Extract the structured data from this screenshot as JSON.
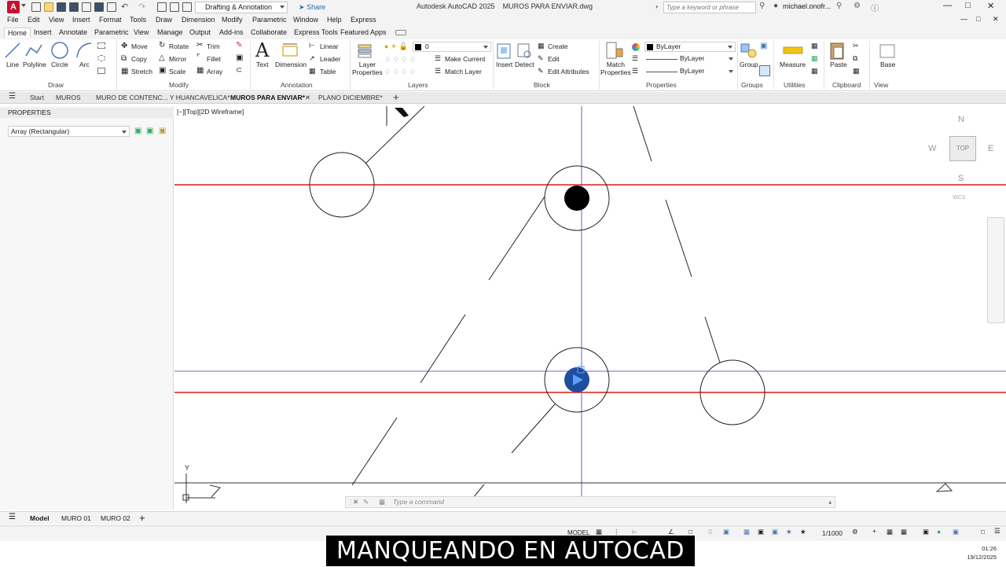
{
  "titlebar": {
    "logo": "A",
    "workspace": "Drafting & Annotation",
    "share": "Share",
    "app_name": "Autodesk AutoCAD 2025",
    "file_name": "MUROS PARA ENVIAR.dwg",
    "search_placeholder": "Type a keyword or phrase",
    "user": "michael.onofr..."
  },
  "menu": [
    "File",
    "Edit",
    "View",
    "Insert",
    "Format",
    "Tools",
    "Draw",
    "Dimension",
    "Modify",
    "Parametric",
    "Window",
    "Help",
    "Express"
  ],
  "ribbon_tabs": [
    "Home",
    "Insert",
    "Annotate",
    "Parametric",
    "View",
    "Manage",
    "Output",
    "Add-ins",
    "Collaborate",
    "Express Tools",
    "Featured Apps"
  ],
  "ribbon": {
    "draw": {
      "line": "Line",
      "polyline": "Polyline",
      "circle": "Circle",
      "arc": "Arc",
      "panel": "Draw"
    },
    "modify": {
      "move": "Move",
      "rotate": "Rotate",
      "trim": "Trim",
      "copy": "Copy",
      "mirror": "Mirror",
      "fillet": "Fillet",
      "stretch": "Stretch",
      "scale": "Scale",
      "array": "Array",
      "panel": "Modify"
    },
    "annotation": {
      "text": "Text",
      "dimension": "Dimension",
      "linear": "Linear",
      "leader": "Leader",
      "table": "Table",
      "panel": "Annotation"
    },
    "layers": {
      "layer_properties": "Layer\nProperties",
      "current_layer": "0",
      "make_current": "Make Current",
      "match_layer": "Match Layer",
      "panel": "Layers"
    },
    "block": {
      "insert": "Insert",
      "detect": "Detect",
      "create": "Create",
      "edit": "Edit",
      "edit_attributes": "Edit Attributes",
      "panel": "Block"
    },
    "properties": {
      "match": "Match\nProperties",
      "color": "ByLayer",
      "linetype": "ByLayer",
      "lineweight": "ByLayer",
      "panel": "Properties"
    },
    "groups": {
      "group": "Group",
      "panel": "Groups"
    },
    "utilities": {
      "measure": "Measure",
      "panel": "Utilities"
    },
    "clipboard": {
      "paste": "Paste",
      "panel": "Clipboard"
    },
    "view": {
      "base": "Base",
      "panel": "View"
    }
  },
  "file_tabs": [
    "Start",
    "MUROS",
    "MURO DE CONTENC... Y HUANCAVELICA*",
    "MUROS PARA ENVIAR*",
    "PLANO DICIEMBRE*"
  ],
  "properties_palette": {
    "title": "PROPERTIES",
    "selection": "Array (Rectangular)"
  },
  "viewport": {
    "label": "[−][Top][2D Wireframe]",
    "viewcube": {
      "n": "N",
      "s": "S",
      "e": "E",
      "w": "W",
      "face": "TOP",
      "wcs": "WCS"
    },
    "ucs_y": "Y"
  },
  "command_line": {
    "placeholder": "Type a command"
  },
  "layout_tabs": [
    "Model",
    "MURO 01",
    "MURO 02"
  ],
  "status_bar": {
    "model": "MODEL",
    "scale": "1/1000"
  },
  "overlay_banner": "MANQUEANDO EN AUTOCAD",
  "taskbar": {
    "time": "01:26",
    "date": "19/12/2025"
  }
}
